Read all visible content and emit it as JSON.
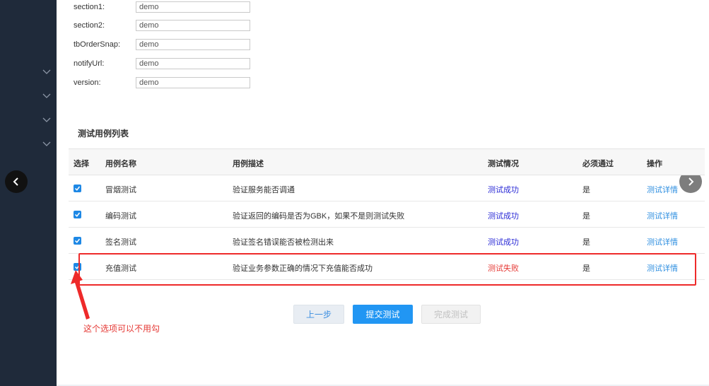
{
  "form": {
    "fields": [
      {
        "label": "section1:",
        "value": "demo"
      },
      {
        "label": "section2:",
        "value": "demo"
      },
      {
        "label": "tbOrderSnap:",
        "value": "demo"
      },
      {
        "label": "notifyUrl:",
        "value": "demo"
      },
      {
        "label": "version:",
        "value": "demo"
      }
    ]
  },
  "section_title": "测试用例列表",
  "table": {
    "headers": [
      "选择",
      "用例名称",
      "用例描述",
      "测试情况",
      "必须通过",
      "操作"
    ],
    "rows": [
      {
        "checked": true,
        "name": "冒烟测试",
        "desc": "验证服务能否调通",
        "status": "测试成功",
        "required": "是",
        "action": "测试详情"
      },
      {
        "checked": true,
        "name": "编码测试",
        "desc": "验证返回的编码是否为GBK，如果不是则测试失败",
        "status": "测试成功",
        "required": "是",
        "action": "测试详情"
      },
      {
        "checked": true,
        "name": "签名测试",
        "desc": "验证签名错误能否被检测出来",
        "status": "测试成功",
        "required": "是",
        "action": "测试详情"
      },
      {
        "checked": true,
        "name": "充值测试",
        "desc": "验证业务参数正确的情况下充值能否成功",
        "status": "测试失败",
        "required": "是",
        "action": "测试详情"
      }
    ]
  },
  "buttons": {
    "prev": "上一步",
    "submit": "提交测试",
    "finish": "完成测试"
  },
  "annotation": {
    "note": "这个选项可以不用勾"
  },
  "colors": {
    "sidebar": "#1f2a3a",
    "primary": "#2196f3",
    "success_text": "#2b2bd6",
    "fail_text": "#e53935",
    "annotation": "#ee2a2a"
  }
}
